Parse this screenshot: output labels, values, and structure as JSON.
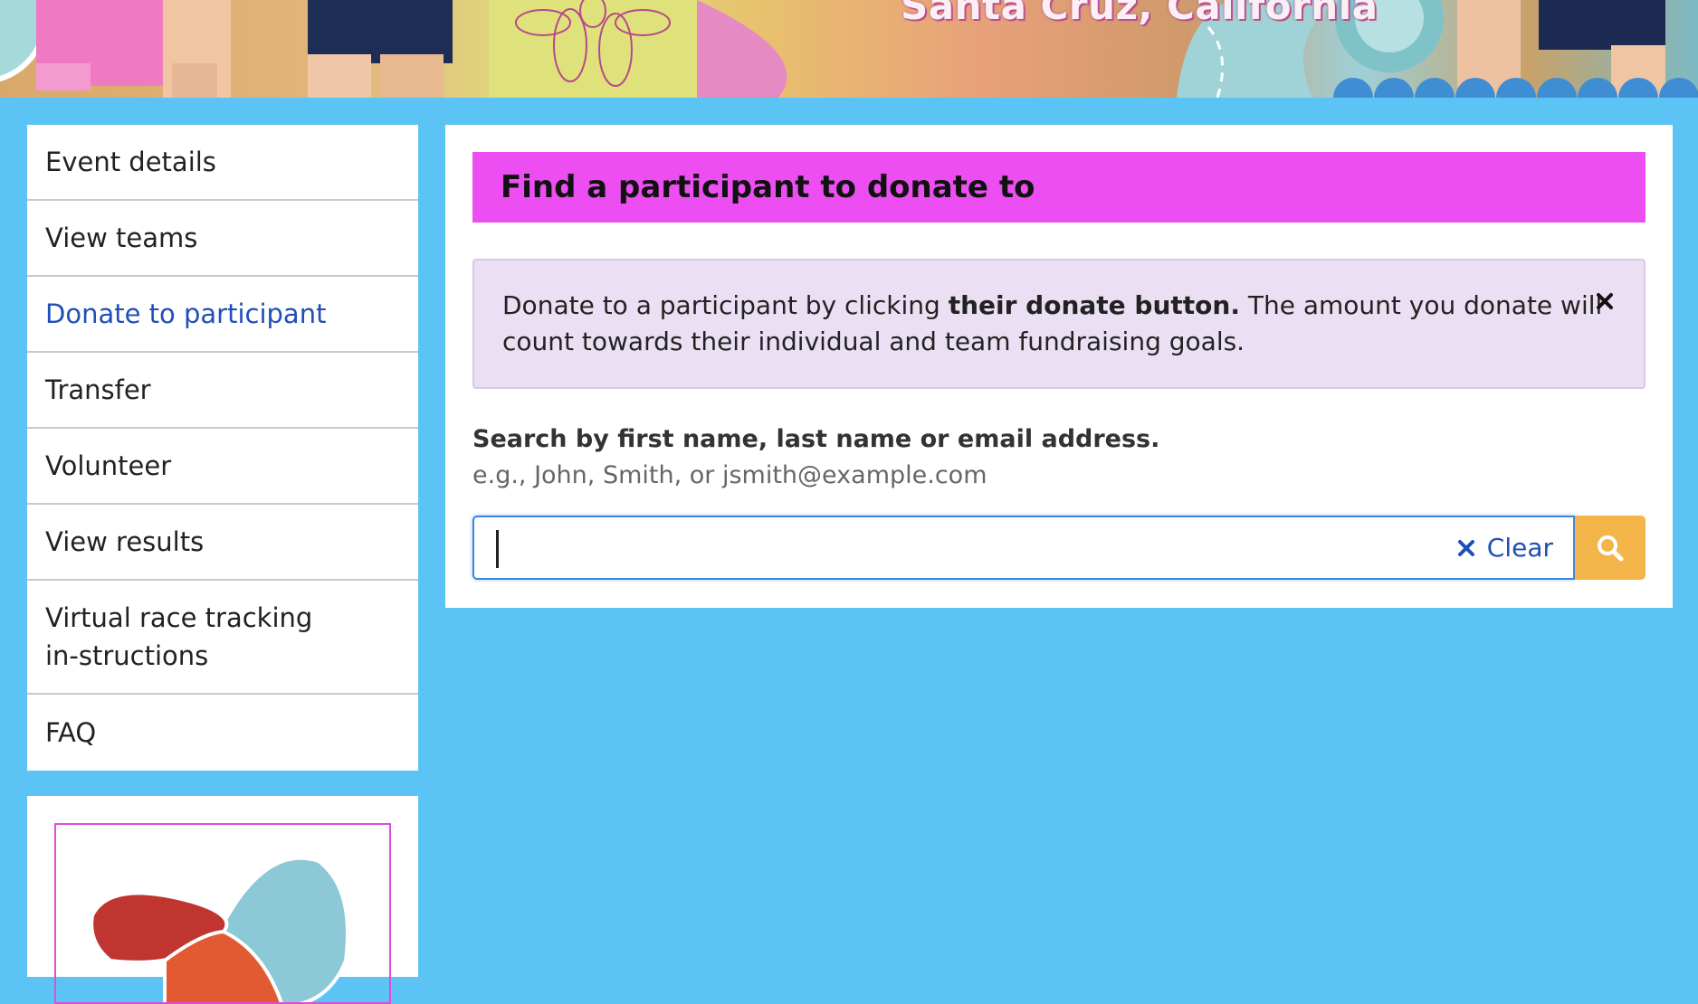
{
  "hero": {
    "location_text": "Santa Cruz, California"
  },
  "sidebar": {
    "items": [
      {
        "label": "Event details",
        "active": false
      },
      {
        "label": "View teams",
        "active": false
      },
      {
        "label": "Donate to participant",
        "active": true
      },
      {
        "label": "Transfer",
        "active": false
      },
      {
        "label": "Volunteer",
        "active": false
      },
      {
        "label": "View results",
        "active": false
      },
      {
        "label": "Virtual race tracking in-structions",
        "active": false
      },
      {
        "label": "FAQ",
        "active": false
      }
    ],
    "logo_icon": "organization-logo"
  },
  "main": {
    "heading": "Find a participant to donate to",
    "info": {
      "text_before": "Donate to a participant by clicking ",
      "text_bold": "their donate button.",
      "text_after": " The amount you donate will count towards their individual and team fundraising goals.",
      "close_icon": "close-icon"
    },
    "search": {
      "label": "Search by first name, last name or email address.",
      "hint": "e.g., John, Smith, or jsmith@example.com",
      "value": "",
      "placeholder": "",
      "clear_label": "Clear",
      "clear_icon": "close-icon",
      "button_icon": "search-icon"
    }
  },
  "colors": {
    "page_background": "#5bc4f5",
    "heading_background": "#ec4ef2",
    "info_background": "#ebe0f3",
    "active_link": "#1f4fb8",
    "search_button": "#f3b54a"
  }
}
